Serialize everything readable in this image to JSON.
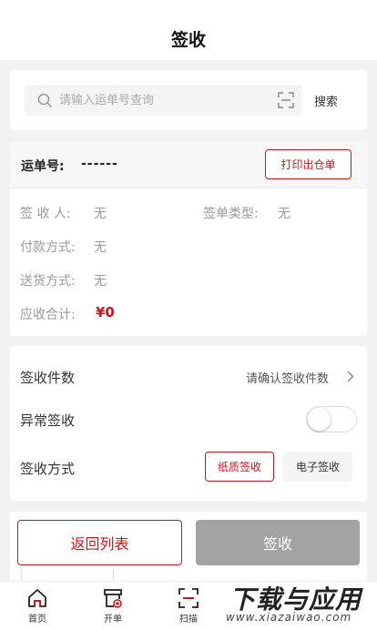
{
  "header": {
    "title": "签收"
  },
  "search": {
    "placeholder": "请输入运单号查询",
    "button_label": "搜索"
  },
  "order": {
    "number_label": "运单号:",
    "number_value": "------",
    "print_button": "打印出仓单",
    "fields": [
      {
        "label": "签 收 人:",
        "value": "无"
      },
      {
        "label": "签单类型:",
        "value": "无"
      },
      {
        "label": "付款方式:",
        "value": "无"
      },
      {
        "label": "送货方式:",
        "value": "无"
      },
      {
        "label": "应收合计:",
        "value": "¥0"
      }
    ]
  },
  "sign": {
    "count_label": "签收件数",
    "count_hint": "请确认签收件数",
    "abnormal_label": "异常签收",
    "abnormal_on": false,
    "method_label": "签收方式",
    "methods": [
      "纸质签收",
      "电子签收"
    ],
    "selected_method": "纸质签收"
  },
  "actions": {
    "back_label": "返回列表",
    "sign_label": "签收"
  },
  "tabbar": {
    "items": [
      {
        "label": "首页",
        "icon": "home-icon"
      },
      {
        "label": "开单",
        "icon": "new-order-icon"
      },
      {
        "label": "扫描",
        "icon": "scan-icon"
      }
    ]
  },
  "watermark": {
    "title": "下载与应用",
    "url": "www.xiazaiwao.com"
  },
  "colors": {
    "accent": "#c8161d",
    "disabled_button": "#a3a3a3",
    "background": "#f2f2f2"
  }
}
